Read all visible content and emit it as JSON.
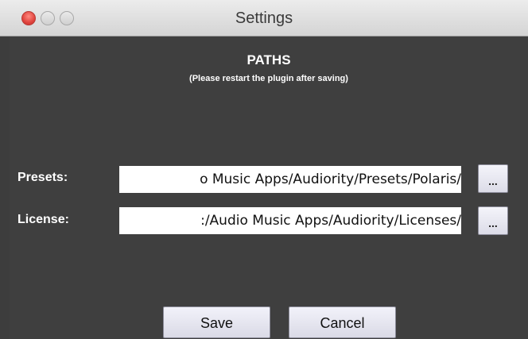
{
  "window": {
    "title": "Settings"
  },
  "section": {
    "heading": "PATHS",
    "note": "(Please restart the plugin after saving)"
  },
  "presets": {
    "label": "Presets:",
    "value": "o Music Apps/Audiority/Presets/Polaris/",
    "browse_label": "..."
  },
  "license": {
    "label": "License:",
    "value": ":/Audio Music Apps/Audiority/Licenses/",
    "browse_label": "..."
  },
  "actions": {
    "save_label": "Save",
    "cancel_label": "Cancel"
  },
  "colors": {
    "panel_bg": "#3f3f3f",
    "close_red": "#e0443e",
    "field_bg": "#ffffff",
    "text_light": "#ffffff"
  }
}
